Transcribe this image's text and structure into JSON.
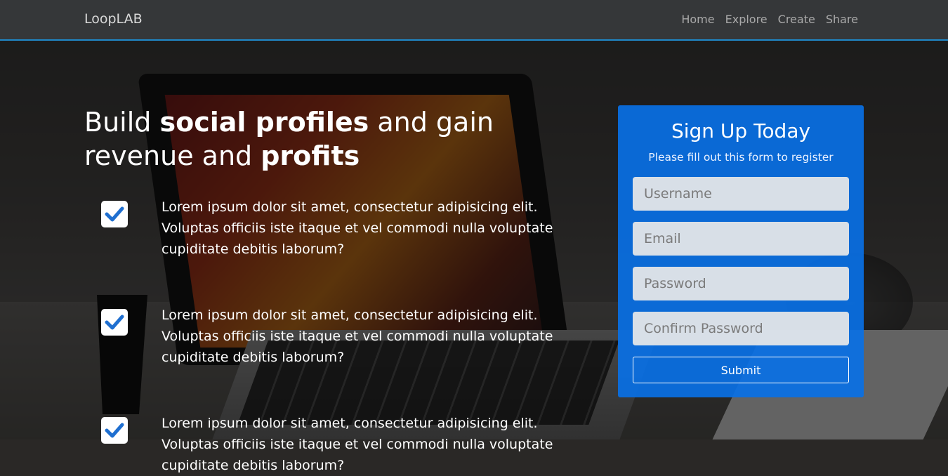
{
  "nav": {
    "brand": "LoopLAB",
    "links": [
      "Home",
      "Explore",
      "Create",
      "Share"
    ]
  },
  "hero": {
    "headline_parts": [
      "Build ",
      "social profiles",
      " and gain revenue and ",
      "profits"
    ],
    "features": [
      "Lorem ipsum dolor sit amet, consectetur adipisicing elit. Voluptas officiis iste itaque et vel commodi nulla voluptate cupiditate debitis laborum?",
      "Lorem ipsum dolor sit amet, consectetur adipisicing elit. Voluptas officiis iste itaque et vel commodi nulla voluptate cupiditate debitis laborum?",
      "Lorem ipsum dolor sit amet, consectetur adipisicing elit. Voluptas officiis iste itaque et vel commodi nulla voluptate cupiditate debitis laborum?"
    ]
  },
  "signup": {
    "title": "Sign Up Today",
    "subtitle": "Please fill out this form to register",
    "fields": {
      "username": "Username",
      "email": "Email",
      "password": "Password",
      "confirm_password": "Confirm Password"
    },
    "submit_label": "Submit"
  },
  "colors": {
    "accent": "#1f88c8",
    "card": "#0970e5",
    "check": "#1f6fd0"
  },
  "icons": {
    "feature_check": "check-icon"
  }
}
